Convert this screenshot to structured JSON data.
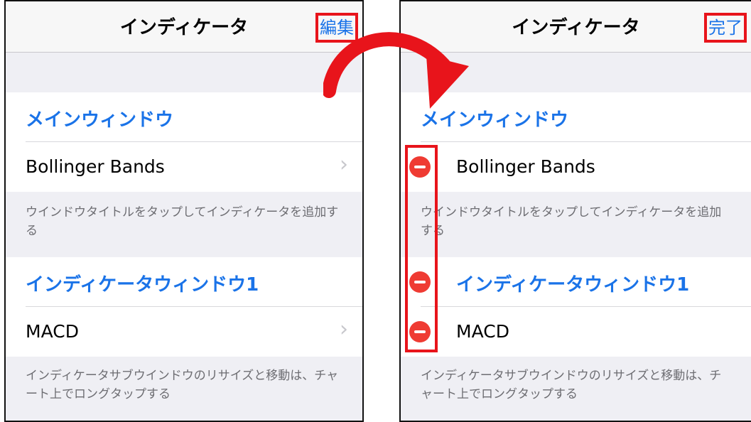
{
  "left_screen": {
    "nav_title": "インディケータ",
    "nav_action": "編集",
    "sections": [
      {
        "header": "メインウィンドウ",
        "row": "Bollinger Bands",
        "footer": "ウインドウタイトルをタップしてインディケータを追加する"
      },
      {
        "header": "インディケータウィンドウ1",
        "row": "MACD",
        "footer": "インディケータサブウインドウのリサイズと移動は、チャート上でロングタップする"
      }
    ]
  },
  "right_screen": {
    "nav_title": "インディケータ",
    "nav_action": "完了",
    "sections": [
      {
        "header": "メインウィンドウ",
        "row": "Bollinger Bands",
        "footer": "ウインドウタイトルをタップしてインディケータを追加する"
      },
      {
        "header": "インディケータウィンドウ1",
        "row": "MACD",
        "footer": "インディケータサブウインドウのリサイズと移動は、チャート上でロングタップする"
      }
    ]
  },
  "colors": {
    "accent": "#1a73e8",
    "highlight": "#e8141b",
    "delete": "#ef3b33",
    "arrow": "#e8141b"
  },
  "icons": {
    "chevron": "chevron-right-icon",
    "delete": "minus-circle-icon",
    "arrow": "curved-arrow-icon"
  }
}
